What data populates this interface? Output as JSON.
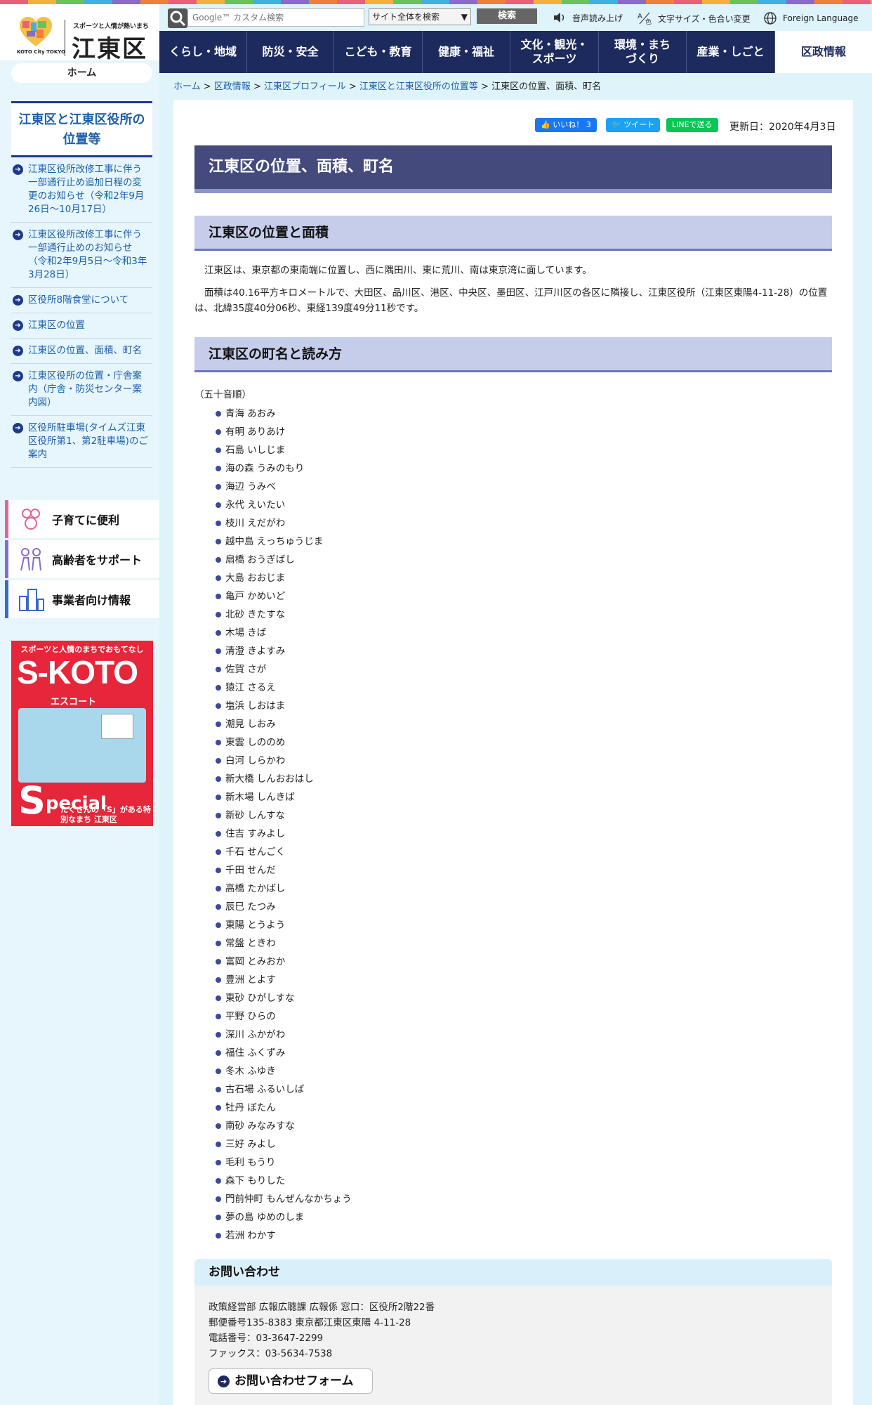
{
  "header": {
    "logo_tagline": "スポーツと人情が熱いまち",
    "logo_name": "江東区",
    "logo_sub": "KOTO City TOKYO",
    "search_placeholder": "Google™ カスタム検索",
    "search_scope": "サイト全体を検索",
    "search_button": "検索",
    "util": {
      "voice": "音声読み上げ",
      "textsize": "文字サイズ・色合い変更",
      "language": "Foreign Language"
    },
    "nav": [
      {
        "label": "くらし・地域"
      },
      {
        "label": "防災・安全"
      },
      {
        "label": "こども・教育"
      },
      {
        "label": "健康・福祉"
      },
      {
        "label": "文化・観光・スポーツ"
      },
      {
        "label": "環境・まちづくり"
      },
      {
        "label": "産業・しごと"
      },
      {
        "label": "区政情報"
      }
    ]
  },
  "sidebar": {
    "home": "ホーム",
    "title": "江東区と江東区役所の位置等",
    "items": [
      {
        "label": "江東区役所改修工事に伴う一部通行止め追加日程の変更のお知らせ（令和2年9月26日～10月17日）"
      },
      {
        "label": "江東区役所改修工事に伴う一部通行止めのお知らせ（令和2年9月5日～令和3年3月28日）"
      },
      {
        "label": "区役所8階食堂について"
      },
      {
        "label": "江東区の位置"
      },
      {
        "label": "江東区の位置、面積、町名"
      },
      {
        "label": "江東区役所の位置・庁舎案内（庁舎・防災センター案内図）"
      },
      {
        "label": "区役所駐車場(タイムズ江東区役所第1、第2駐車場)のご案内"
      }
    ],
    "quick": [
      {
        "label": "子育てに便利",
        "color": "#e0659a"
      },
      {
        "label": "高齢者をサポート",
        "color": "#8a6bc7"
      },
      {
        "label": "事業者向け情報",
        "color": "#3a6ac7"
      }
    ],
    "banner": {
      "top": "スポーツと人情のまちでおもてなし",
      "skoto": "S-KOTO",
      "escort": "エスコート",
      "special": "pecial",
      "special_s": "S",
      "bottom": "たくさんの「S」がある特別なまち 江東区"
    }
  },
  "breadcrumb": {
    "items": [
      "ホーム",
      "区政情報",
      "江東区プロフィール",
      "江東区と江東区役所の位置等"
    ],
    "current": "江東区の位置、面積、町名"
  },
  "social": {
    "like": "いいね！ 3",
    "tweet": "ツイート",
    "line": "LINEで送る"
  },
  "updated": "更新日：2020年4月3日",
  "page_title": "江東区の位置、面積、町名",
  "section1": {
    "heading": "江東区の位置と面積",
    "p1": "江東区は、東京都の東南端に位置し、西に隅田川、東に荒川、南は東京湾に面しています。",
    "p2": "面積は40.16平方キロメートルで、大田区、品川区、港区、中央区、墨田区、江戸川区の各区に隣接し、江東区役所（江東区東陽4-11-28）の位置は、北緯35度40分06秒、東経139度49分11秒です。"
  },
  "section2": {
    "heading": "江東区の町名と読み方",
    "order_note": "（五十音順）",
    "towns": [
      "青海 あおみ",
      "有明 ありあけ",
      "石島 いしじま",
      "海の森 うみのもり",
      "海辺 うみべ",
      "永代 えいたい",
      "枝川 えだがわ",
      "越中島 えっちゅうじま",
      "扇橋 おうぎばし",
      "大島 おおじま",
      "亀戸 かめいど",
      "北砂 きたすな",
      "木場 きば",
      "清澄 きよすみ",
      "佐賀 さが",
      "猿江 さるえ",
      "塩浜 しおはま",
      "潮見 しおみ",
      "東雲 しののめ",
      "白河 しらかわ",
      "新大橋 しんおおはし",
      "新木場 しんきば",
      "新砂 しんすな",
      "住吉 すみよし",
      "千石 せんごく",
      "千田 せんだ",
      "高橋 たかばし",
      "辰巳 たつみ",
      "東陽 とうよう",
      "常盤 ときわ",
      "富岡 とみおか",
      "豊洲 とよす",
      "東砂 ひがしすな",
      "平野 ひらの",
      "深川 ふかがわ",
      "福住 ふくずみ",
      "冬木 ふゆき",
      "古石場 ふるいしば",
      "牡丹 ぼたん",
      "南砂 みなみすな",
      "三好 みよし",
      "毛利 もうり",
      "森下 もりした",
      "門前仲町 もんぜんなかちょう",
      "夢の島 ゆめのしま",
      "若洲 わかす"
    ]
  },
  "contact": {
    "heading": "お問い合わせ",
    "line1": "政策経営部 広報広聴課 広報係 窓口：区役所2階22番",
    "line2": "郵便番号135-8383 東京都江東区東陽 4-11-28",
    "line3": "電話番号：03-3647-2299",
    "line4": "ファックス：03-5634-7538",
    "form_button": "お問い合わせフォーム"
  }
}
